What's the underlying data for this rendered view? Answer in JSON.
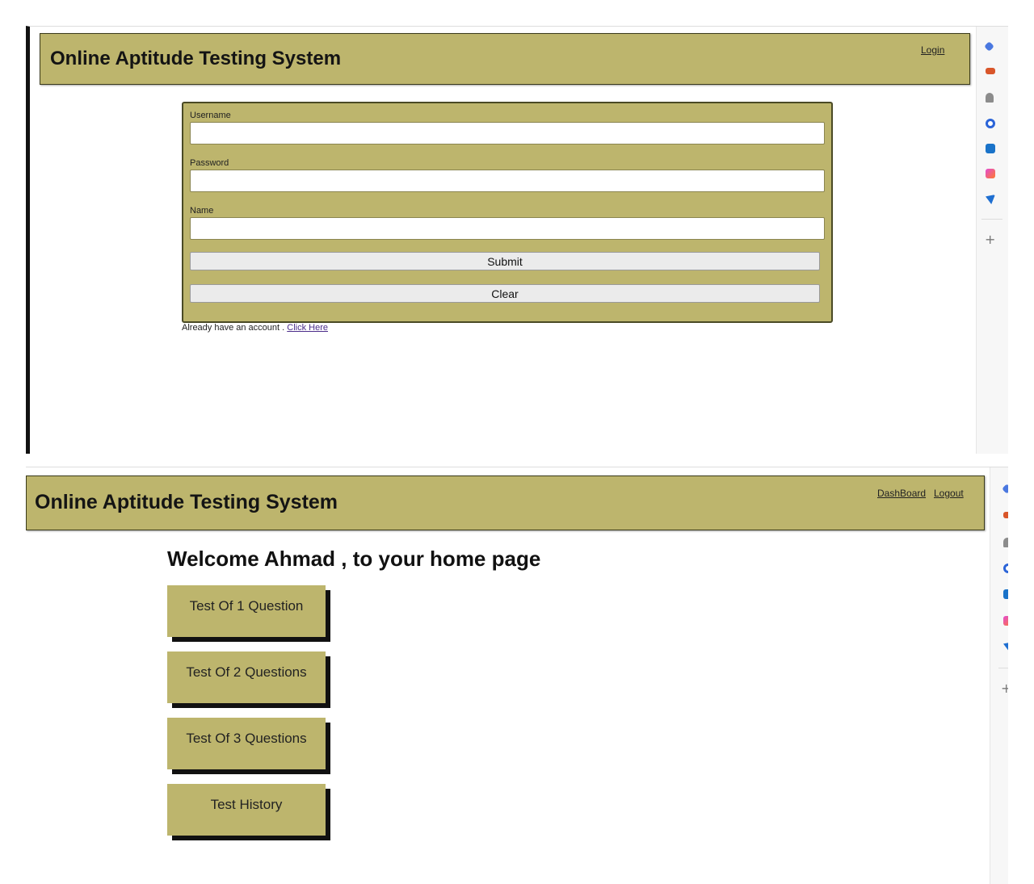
{
  "colors": {
    "header_bg": "#bdb56d",
    "panel_bg": "#bdb56d",
    "link_purple": "#4b2c8a"
  },
  "register_page": {
    "site_title": "Online Aptitude Testing System",
    "nav": {
      "login": "Login"
    },
    "form": {
      "username_label": "Username",
      "password_label": "Password",
      "name_label": "Name",
      "username_value": "",
      "password_value": "",
      "name_value": "",
      "submit_label": "Submit",
      "clear_label": "Clear"
    },
    "account_prompt": "Already have an account . ",
    "account_link": "Click Here"
  },
  "home_page": {
    "site_title": "Online Aptitude Testing System",
    "nav": {
      "dashboard": "DashBoard",
      "logout": "Logout"
    },
    "welcome": "Welcome Ahmad , to your home page",
    "tiles": [
      "Test Of 1 Question",
      "Test Of 2 Questions",
      "Test Of 3 Questions",
      "Test History"
    ]
  },
  "browser_sidebar": {
    "icons": [
      "tag-icon",
      "toolbox-icon",
      "persons-icon",
      "office-icon",
      "outlook-icon",
      "copilot-icon",
      "send-icon"
    ],
    "add_label": "+"
  }
}
